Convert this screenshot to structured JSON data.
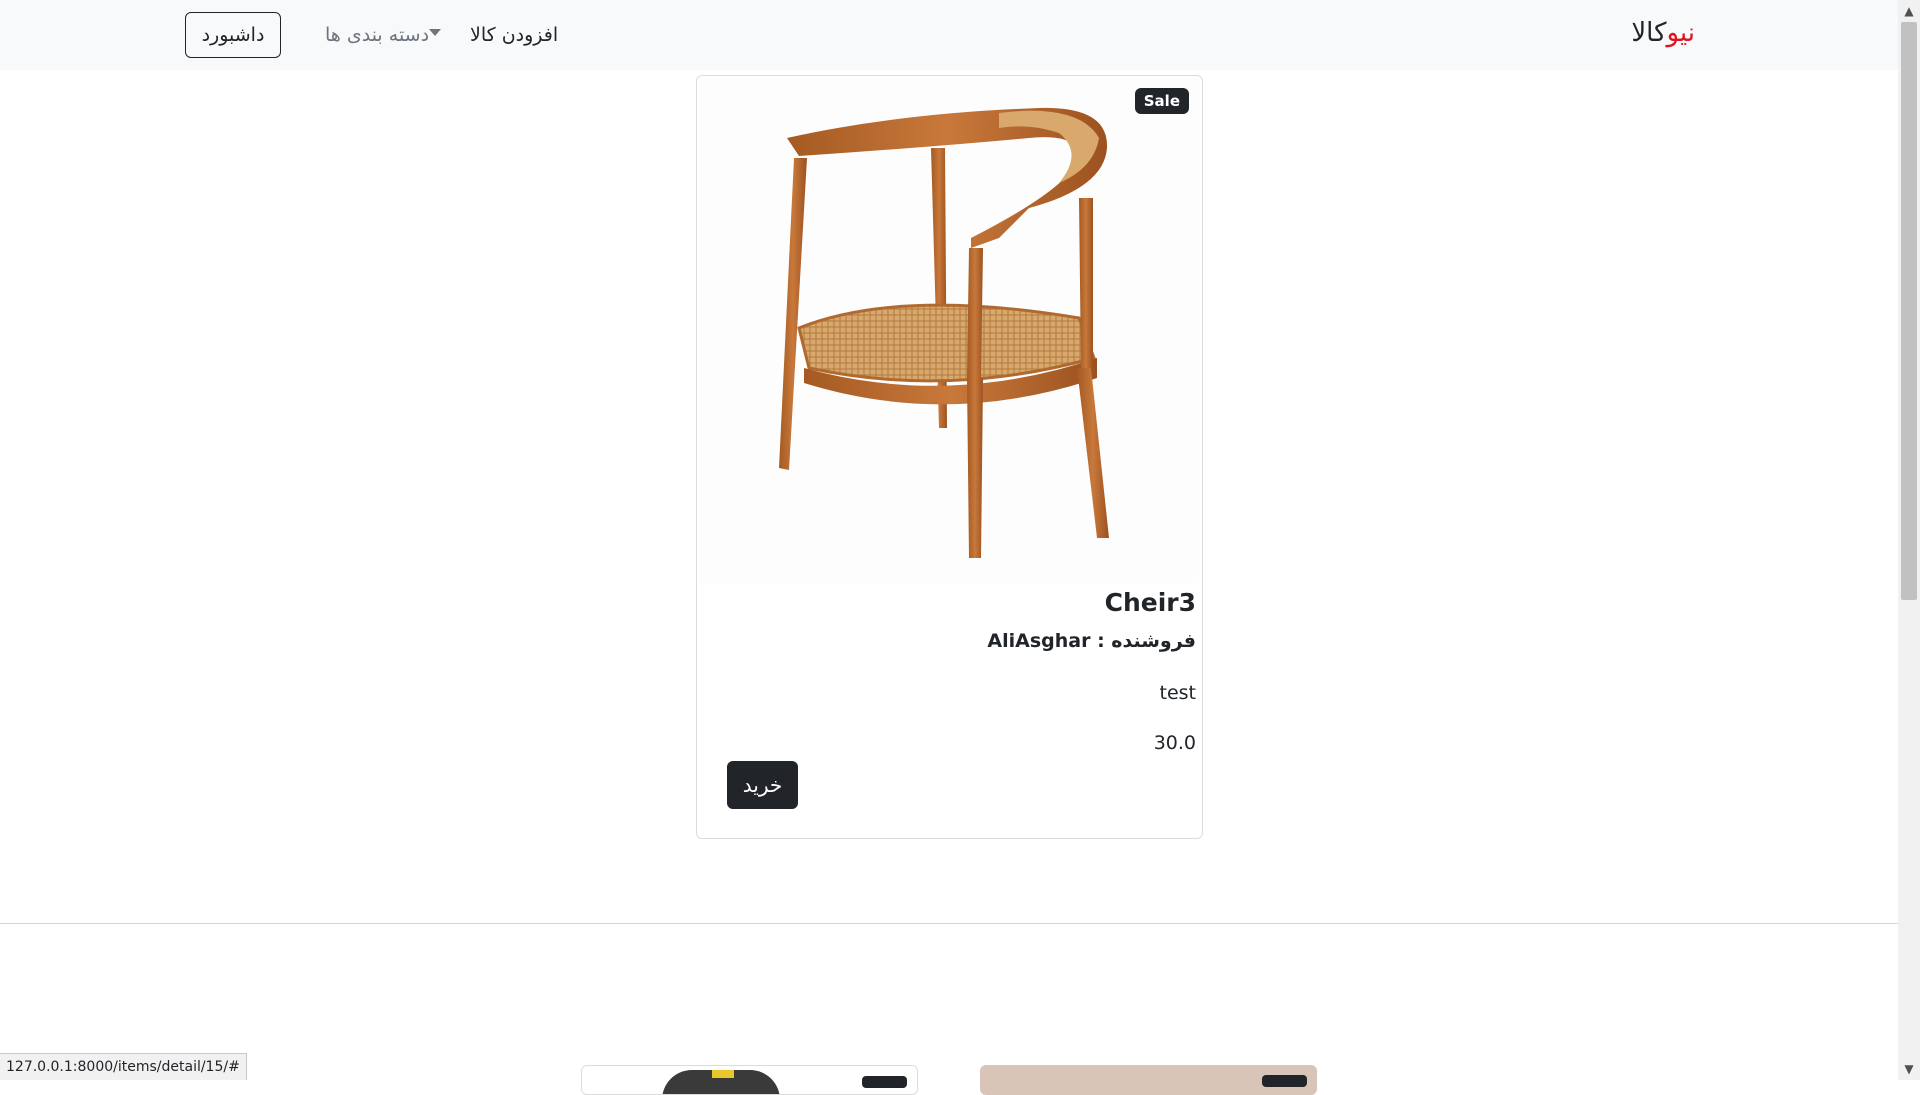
{
  "navbar": {
    "brand_accent": "نیو",
    "brand_rest": "کالا",
    "brand_accent_color": "#e0141e",
    "add_item_label": "افزودن کالا",
    "categories_label": "دسته بندی ها",
    "dashboard_label": "داشبورد"
  },
  "product": {
    "badge": "Sale",
    "title": "Cheir3",
    "seller": "فروشنده : AliAsghar",
    "description": "test",
    "price": "30.0",
    "buy_label": "خرید",
    "image_icon": "wooden-chair-image"
  },
  "statusbar": {
    "url": "127.0.0.1:8000/items/detail/15/#"
  },
  "colors": {
    "navbar_bg": "#f8f9fa",
    "dark": "#212529",
    "muted": "#6c757d"
  }
}
